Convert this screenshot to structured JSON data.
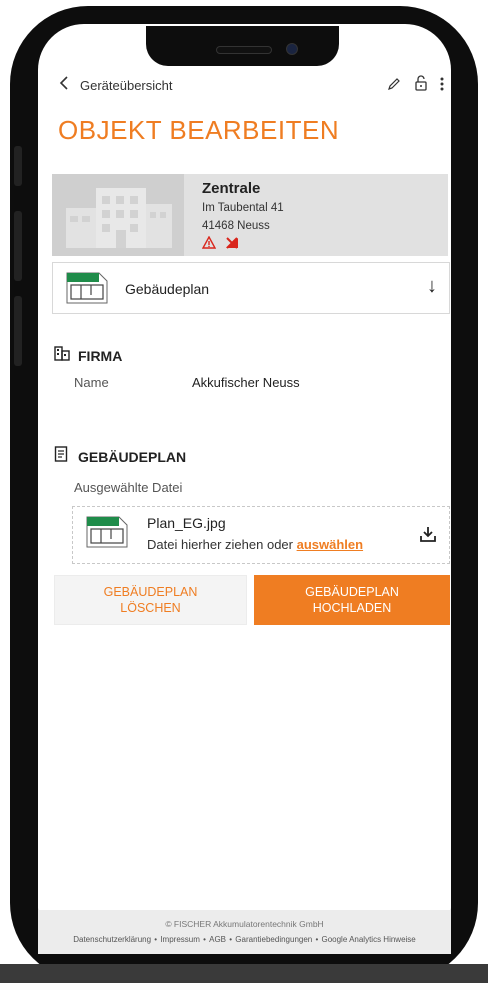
{
  "nav": {
    "back_label": "Geräteübersicht"
  },
  "page": {
    "title": "OBJEKT BEARBEITEN"
  },
  "building": {
    "name": "Zentrale",
    "street": "Im Taubental 41",
    "city": "41468 Neuss",
    "alert_icon": "⚠",
    "status_icon": "✕"
  },
  "plan_row": {
    "label": "Gebäudeplan",
    "download_glyph": "↓"
  },
  "firma": {
    "heading": "FIRMA",
    "name_label": "Name",
    "name_value": "Akkufischer Neuss"
  },
  "gebaeudeplan": {
    "heading": "GEBÄUDEPLAN",
    "selected_label": "Ausgewählte Datei",
    "file_name": "Plan_EG.jpg",
    "hint_text": "Datei hierher ziehen oder ",
    "hint_link": "auswählen"
  },
  "buttons": {
    "delete_line1": "GEBÄUDEPLAN",
    "delete_line2": "LÖSCHEN",
    "upload_line1": "GEBÄUDEPLAN",
    "upload_line2": "HOCHLADEN"
  },
  "footer": {
    "copyright": "© FISCHER Akkumulatorentechnik GmbH",
    "links": [
      "Datenschutzerklärung",
      "Impressum",
      "AGB",
      "Garantiebedingungen",
      "Google Analytics Hinweise"
    ]
  },
  "colors": {
    "accent": "#ef7d22",
    "alert": "#d9261c"
  },
  "icons": {
    "back": "chevron-left-icon",
    "edit": "pencil-icon",
    "lock": "unlock-icon",
    "more": "more-vertical-icon",
    "firma": "building-icon",
    "plan": "document-icon",
    "upload": "upload-icon"
  }
}
